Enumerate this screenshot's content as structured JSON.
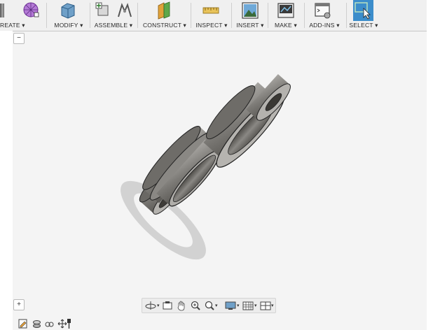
{
  "toolbar": {
    "groups": [
      {
        "label": "REATE ▾"
      },
      {
        "label": "MODIFY ▾"
      },
      {
        "label": "ASSEMBLE ▾"
      },
      {
        "label": "CONSTRUCT ▾"
      },
      {
        "label": "INSPECT ▾"
      },
      {
        "label": "INSERT ▾"
      },
      {
        "label": "MAKE ▾"
      },
      {
        "label": "ADD-INS ▾"
      },
      {
        "label": "SELECT ▾"
      }
    ]
  },
  "browser_toggle": {
    "glyph": "−"
  },
  "comments_toggle": {
    "glyph": "+"
  },
  "navbar": {
    "icons": [
      "orbit-icon",
      "look-at-icon",
      "pan-icon",
      "zoom-icon",
      "zoom-window-icon",
      "display-settings-icon",
      "grid-settings-icon",
      "viewports-icon"
    ]
  },
  "timeline": {
    "icons": [
      "sketch-icon",
      "edit-icon",
      "joint-icon",
      "move-icon"
    ]
  },
  "colors": {
    "select_active": "#3c8dcb",
    "model_metal": "#8c8a86",
    "shadow": "#d0d0d0"
  }
}
